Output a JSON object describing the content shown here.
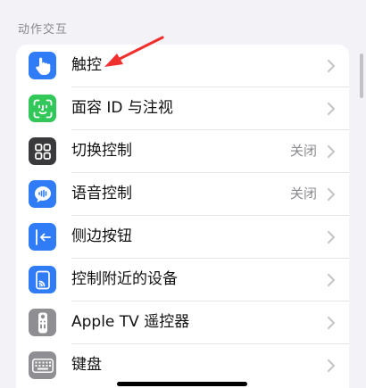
{
  "section": {
    "header": "动作交互"
  },
  "rows": [
    {
      "label": "触控",
      "icon": "hand-touch-icon",
      "color": "#2f7cf6",
      "value": ""
    },
    {
      "label": "面容 ID 与注视",
      "icon": "face-id-icon",
      "color": "#32c759",
      "value": ""
    },
    {
      "label": "切换控制",
      "icon": "grid-squares-icon",
      "color": "#3a3a3c",
      "value": "关闭"
    },
    {
      "label": "语音控制",
      "icon": "voice-control-icon",
      "color": "#2f7cf6",
      "value": "关闭"
    },
    {
      "label": "侧边按钮",
      "icon": "side-button-icon",
      "color": "#2f7cf6",
      "value": ""
    },
    {
      "label": "控制附近的设备",
      "icon": "device-cast-icon",
      "color": "#2f7cf6",
      "value": ""
    },
    {
      "label": "Apple TV 遥控器",
      "icon": "remote-icon",
      "color": "#8e8e93",
      "value": ""
    },
    {
      "label": "键盘",
      "icon": "keyboard-icon",
      "color": "#8e8e93",
      "value": ""
    }
  ],
  "colors": {
    "annotation_arrow": "#f0302e",
    "background": "#f2f2f7",
    "chevron": "#c4c4c7"
  }
}
